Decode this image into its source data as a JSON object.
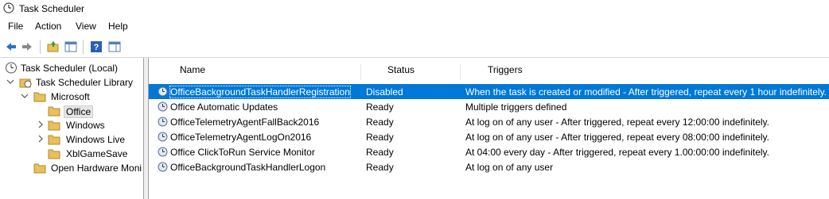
{
  "window": {
    "title": "Task Scheduler"
  },
  "menu": {
    "file": "File",
    "action": "Action",
    "view": "View",
    "help": "Help"
  },
  "toolbar": {
    "buttons": [
      "back-arrow-icon",
      "forward-arrow-icon",
      "up-folder-icon",
      "show-hide-console-tree-icon",
      "help-icon",
      "action-pane-icon"
    ]
  },
  "tree": {
    "root": "Task Scheduler (Local)",
    "library": "Task Scheduler Library",
    "microsoft": "Microsoft",
    "office": "Office",
    "windows": "Windows",
    "windows_live": "Windows Live",
    "xblgamesave": "XblGameSave",
    "open_hw": "Open Hardware Moni"
  },
  "table": {
    "columns": {
      "name": "Name",
      "status": "Status",
      "triggers": "Triggers"
    },
    "rows": [
      {
        "name": "OfficeBackgroundTaskHandlerRegistration",
        "status": "Disabled",
        "triggers": "When the task is created or modified - After triggered, repeat every 1 hour indefinitely."
      },
      {
        "name": "Office Automatic Updates",
        "status": "Ready",
        "triggers": "Multiple triggers defined"
      },
      {
        "name": "OfficeTelemetryAgentFallBack2016",
        "status": "Ready",
        "triggers": "At log on of any user - After triggered, repeat every 12:00:00 indefinitely."
      },
      {
        "name": "OfficeTelemetryAgentLogOn2016",
        "status": "Ready",
        "triggers": "At log on of any user - After triggered, repeat every 08:00:00 indefinitely."
      },
      {
        "name": "Office ClickToRun Service Monitor",
        "status": "Ready",
        "triggers": "At 04:00 every day - After triggered, repeat every 1.00:00:00 indefinitely."
      },
      {
        "name": "OfficeBackgroundTaskHandlerLogon",
        "status": "Ready",
        "triggers": "At log on of any user"
      }
    ]
  },
  "colors": {
    "selection": "#0078d7",
    "folder": "#e8c15a"
  }
}
